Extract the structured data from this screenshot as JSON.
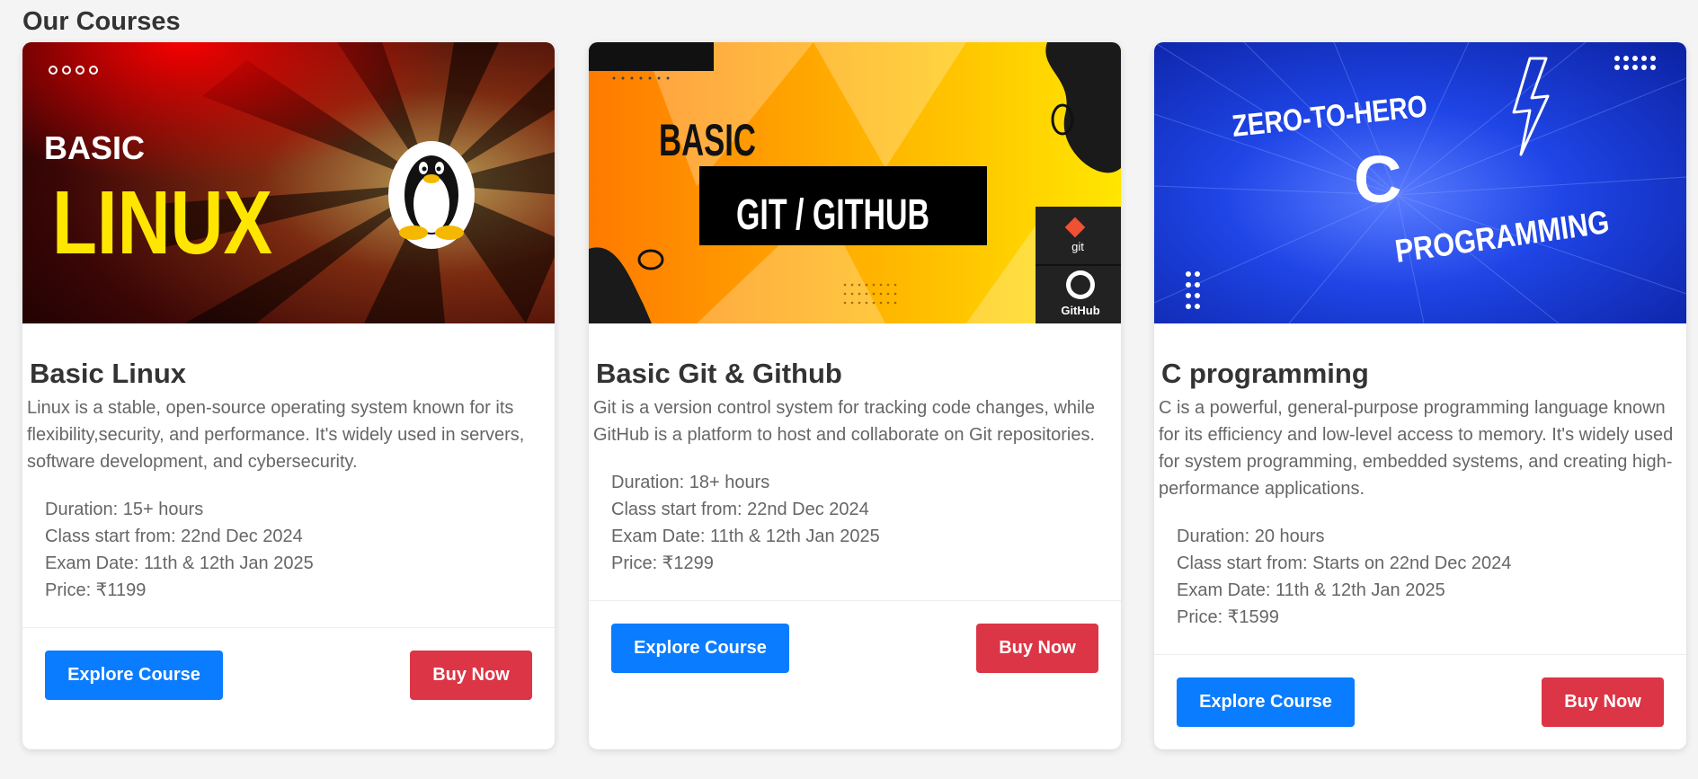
{
  "page": {
    "title": "Our Courses"
  },
  "courses": [
    {
      "banner": {
        "line1": "BASIC",
        "line2": "LINUX"
      },
      "title": "Basic Linux",
      "description": "Linux is a stable, open-source operating system known for its flexibility,security, and performance. It's widely used in servers, software development, and cybersecurity.",
      "duration": "Duration: 15+ hours",
      "start": "Class start from: 22nd Dec 2024",
      "exam": "Exam Date: 11th & 12th Jan 2025",
      "price": "Price: ₹1199",
      "explore_label": "Explore Course",
      "buy_label": "Buy Now"
    },
    {
      "banner": {
        "line1": "BASIC",
        "line2": "GIT / GITHUB",
        "git_logo": "git",
        "github_logo": "GitHub"
      },
      "title": "Basic Git & Github",
      "description": "Git is a version control system for tracking code changes, while GitHub is a platform to host and collaborate on Git repositories.",
      "duration": "Duration: 18+ hours",
      "start": "Class start from: 22nd Dec 2024",
      "exam": "Exam Date: 11th & 12th Jan 2025",
      "price": "Price: ₹1299",
      "explore_label": "Explore Course",
      "buy_label": "Buy Now"
    },
    {
      "banner": {
        "line1": "ZERO-TO-HERO",
        "line2": "C",
        "line3": "PROGRAMMING"
      },
      "title": "C programming",
      "description": "C is a powerful, general-purpose programming  language known for its efficiency and low-level access to memory. It's widely used for system programming, embedded systems, and creating high-performance applications.",
      "duration": "Duration: 20 hours",
      "start": "Class start from: Starts on 22nd Dec 2024",
      "exam": "Exam Date: 11th & 12th Jan 2025",
      "price": "Price: ₹1599",
      "explore_label": "Explore Course",
      "buy_label": "Buy Now"
    }
  ],
  "colors": {
    "explore_button": "#0a7cff",
    "buy_button": "#dc3545",
    "linux_banner_red": "#d40000",
    "linux_banner_yellow": "#ffe600",
    "git_banner_orange": "#ff8a00",
    "git_banner_yellow": "#ffe000",
    "c_banner_blue": "#0b2bd6"
  },
  "icons": [
    "tux-penguin-icon",
    "git-logo-icon",
    "github-logo-icon",
    "lightning-bolt-icon"
  ]
}
